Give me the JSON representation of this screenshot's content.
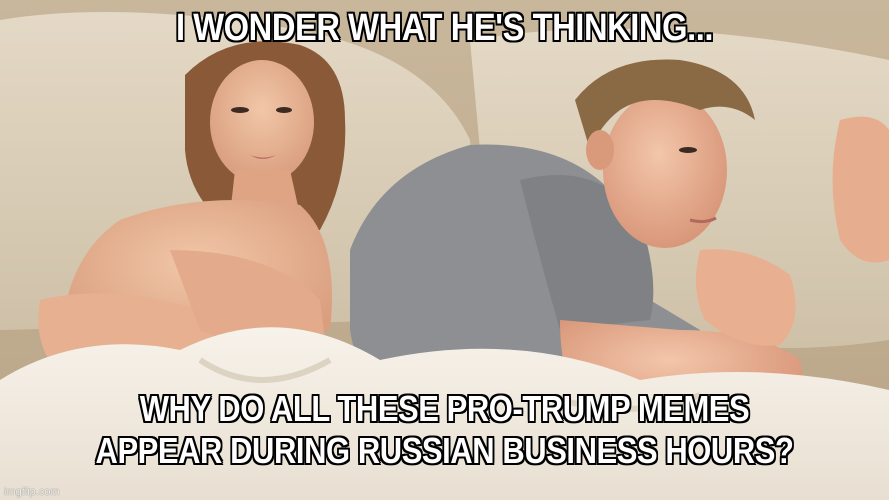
{
  "meme": {
    "top_text": "I WONDER WHAT HE'S THINKING...",
    "bottom_line_1": "WHY DO ALL THESE PRO-TRUMP MEMES",
    "bottom_line_2": "APPEAR DURING RUSSIAN BUSINESS HOURS?",
    "watermark": "imgflip.com"
  },
  "colors": {
    "sheet": "#f3ede4",
    "pillow": "#d9cdb9",
    "skin": "#e9b99a",
    "shirt": "#8d8f92",
    "hair_woman": "#8a5a38",
    "hair_man": "#8a6a45"
  }
}
